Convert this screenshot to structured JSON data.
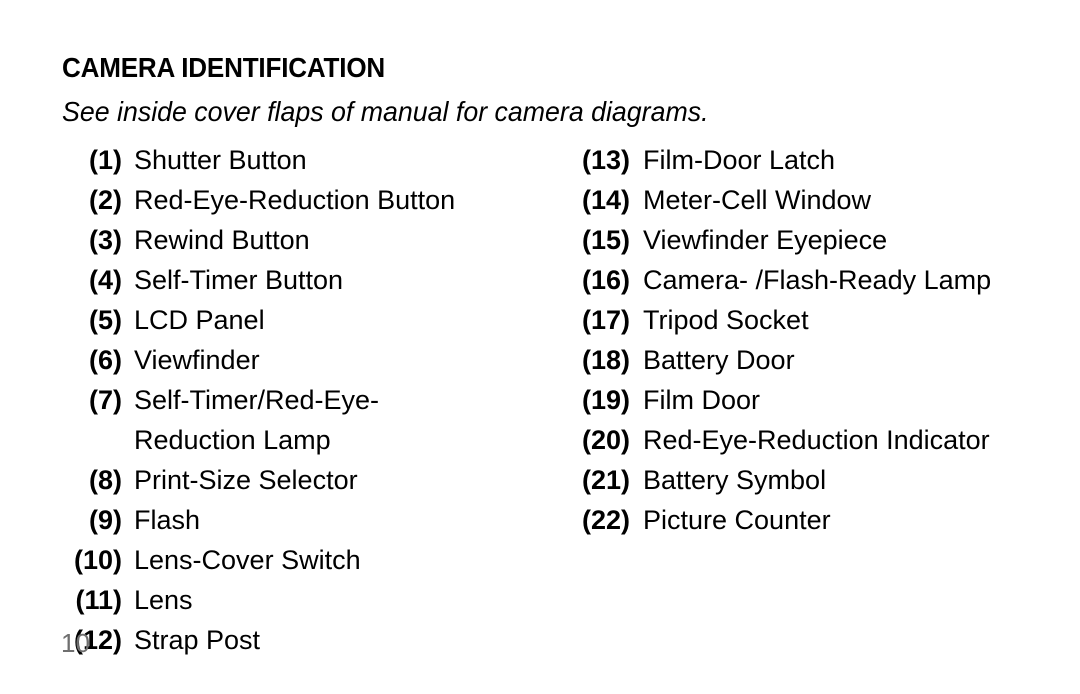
{
  "document": {
    "heading": "CAMERA IDENTIFICATION",
    "subtitle": "See inside cover flaps of manual for camera diagrams.",
    "page_number": "10"
  },
  "left_column": [
    {
      "number": "(1)",
      "label": "Shutter Button"
    },
    {
      "number": "(2)",
      "label": "Red-Eye-Reduction Button"
    },
    {
      "number": "(3)",
      "label": "Rewind Button"
    },
    {
      "number": "(4)",
      "label": "Self-Timer Button"
    },
    {
      "number": "(5)",
      "label": "LCD Panel"
    },
    {
      "number": "(6)",
      "label": "Viewfinder"
    },
    {
      "number": "(7)",
      "label": "Self-Timer/Red-Eye-\nReduction Lamp"
    },
    {
      "number": "(8)",
      "label": "Print-Size Selector"
    },
    {
      "number": "(9)",
      "label": "Flash"
    },
    {
      "number": "(10)",
      "label": "Lens-Cover Switch"
    },
    {
      "number": "(11)",
      "label": "Lens"
    },
    {
      "number": "(12)",
      "label": "Strap Post"
    }
  ],
  "right_column": [
    {
      "number": "(13)",
      "label": "Film-Door Latch"
    },
    {
      "number": "(14)",
      "label": "Meter-Cell Window"
    },
    {
      "number": "(15)",
      "label": "Viewfinder Eyepiece"
    },
    {
      "number": "(16)",
      "label": "Camera- /Flash-Ready Lamp"
    },
    {
      "number": "(17)",
      "label": "Tripod Socket"
    },
    {
      "number": "(18)",
      "label": "Battery Door"
    },
    {
      "number": "(19)",
      "label": "Film Door"
    },
    {
      "number": "(20)",
      "label": "Red-Eye-Reduction Indicator"
    },
    {
      "number": "(21)",
      "label": "Battery Symbol"
    },
    {
      "number": "(22)",
      "label": "Picture Counter"
    }
  ]
}
